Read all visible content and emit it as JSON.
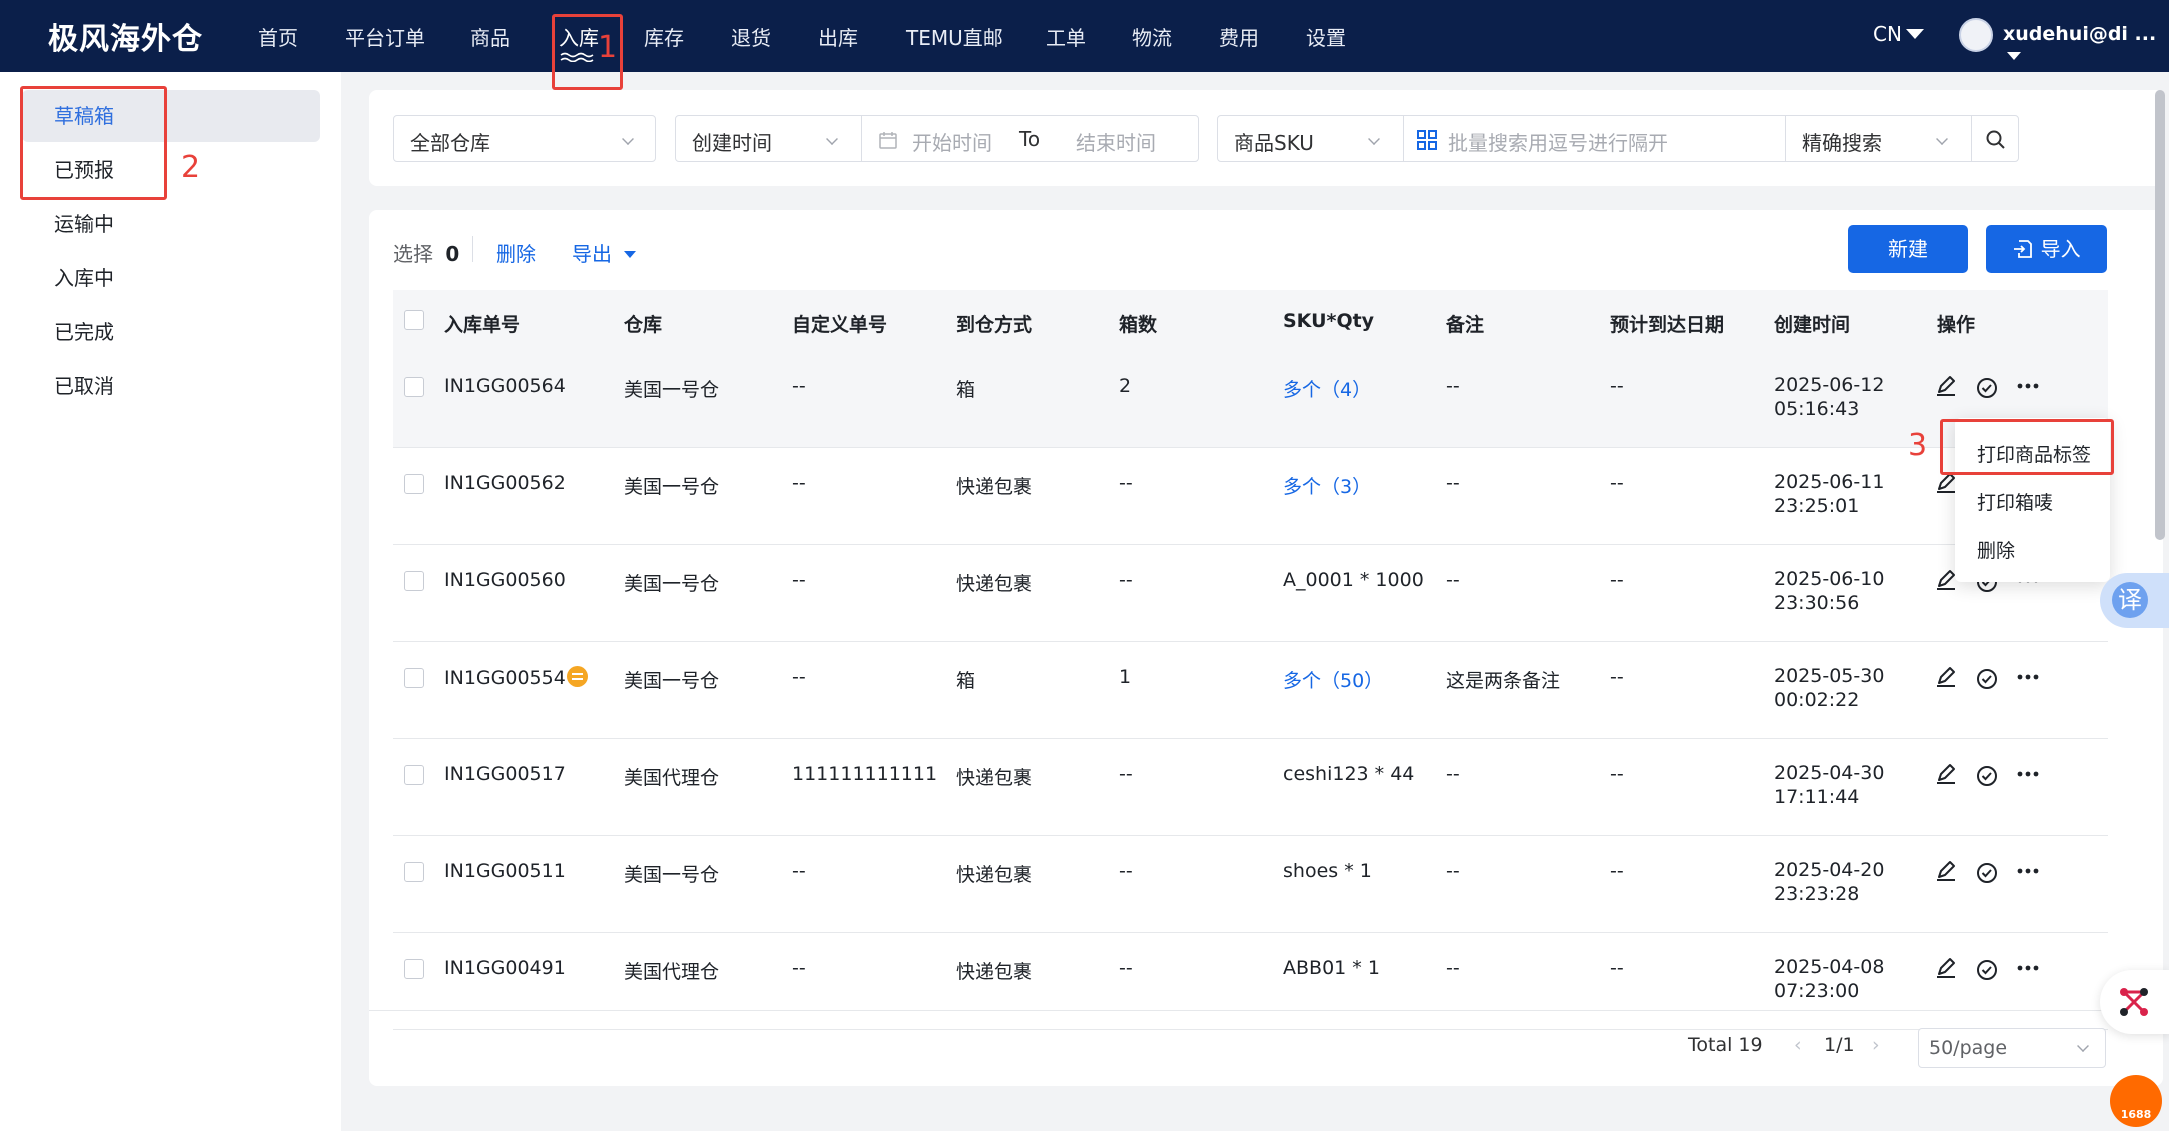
{
  "brand": "极风海外仓",
  "nav": [
    {
      "label": "首页"
    },
    {
      "label": "平台订单"
    },
    {
      "label": "商品"
    },
    {
      "label": "入库"
    },
    {
      "label": "库存"
    },
    {
      "label": "退货"
    },
    {
      "label": "出库"
    },
    {
      "label": "TEMU直邮"
    },
    {
      "label": "工单"
    },
    {
      "label": "物流"
    },
    {
      "label": "费用"
    },
    {
      "label": "设置"
    }
  ],
  "lang": "CN",
  "user": "xudehui@di ...",
  "annotations": {
    "n1": "1",
    "n2": "2",
    "n3": "3"
  },
  "sidebar": {
    "items": [
      {
        "label": "草稿箱"
      },
      {
        "label": "已预报"
      },
      {
        "label": "运输中"
      },
      {
        "label": "入库中"
      },
      {
        "label": "已完成"
      },
      {
        "label": "已取消"
      }
    ]
  },
  "filters": {
    "warehouse": "全部仓库",
    "time_type": "创建时间",
    "start_placeholder": "开始时间",
    "to_label": "To",
    "end_placeholder": "结束时间",
    "sku_type": "商品SKU",
    "batch_placeholder": "批量搜索用逗号进行隔开",
    "match_mode": "精确搜索"
  },
  "toolbar": {
    "selected_label": "选择",
    "selected_count": "0",
    "delete": "删除",
    "export": "导出",
    "new": "新建",
    "import": "导入"
  },
  "table": {
    "headers": {
      "order_no": "入库单号",
      "warehouse": "仓库",
      "custom_no": "自定义单号",
      "arrival": "到仓方式",
      "boxes": "箱数",
      "sku_qty": "SKU*Qty",
      "remark": "备注",
      "eta": "预计到达日期",
      "created": "创建时间",
      "ops": "操作"
    },
    "rows": [
      {
        "order_no": "IN1GG00564",
        "warehouse": "美国一号仓",
        "custom_no": "--",
        "arrival": "箱",
        "boxes": "2",
        "sku_qty": "多个（4）",
        "remark": "--",
        "eta": "--",
        "created_date": "2025-06-12",
        "created_time": "05:16:43"
      },
      {
        "order_no": "IN1GG00562",
        "warehouse": "美国一号仓",
        "custom_no": "--",
        "arrival": "快递包裹",
        "boxes": "--",
        "sku_qty": "多个（3）",
        "remark": "--",
        "eta": "--",
        "created_date": "2025-06-11",
        "created_time": "23:25:01"
      },
      {
        "order_no": "IN1GG00560",
        "warehouse": "美国一号仓",
        "custom_no": "--",
        "arrival": "快递包裹",
        "boxes": "--",
        "sku_qty": "A_0001 * 1000",
        "remark": "--",
        "eta": "--",
        "created_date": "2025-06-10",
        "created_time": "23:30:56"
      },
      {
        "order_no": "IN1GG00554",
        "warehouse": "美国一号仓",
        "custom_no": "--",
        "arrival": "箱",
        "boxes": "1",
        "sku_qty": "多个（50）",
        "remark": "这是两条备注",
        "eta": "--",
        "created_date": "2025-05-30",
        "created_time": "00:02:22"
      },
      {
        "order_no": "IN1GG00517",
        "warehouse": "美国代理仓",
        "custom_no": "111111111111",
        "arrival": "快递包裹",
        "boxes": "--",
        "sku_qty": "ceshi123 * 44",
        "remark": "--",
        "eta": "--",
        "created_date": "2025-04-30",
        "created_time": "17:11:44"
      },
      {
        "order_no": "IN1GG00511",
        "warehouse": "美国一号仓",
        "custom_no": "--",
        "arrival": "快递包裹",
        "boxes": "--",
        "sku_qty": "shoes * 1",
        "remark": "--",
        "eta": "--",
        "created_date": "2025-04-20",
        "created_time": "23:23:28"
      },
      {
        "order_no": "IN1GG00491",
        "warehouse": "美国代理仓",
        "custom_no": "--",
        "arrival": "快递包裹",
        "boxes": "--",
        "sku_qty": "ABB01 * 1",
        "remark": "--",
        "eta": "--",
        "created_date": "2025-04-08",
        "created_time": "07:23:00"
      }
    ]
  },
  "menu": {
    "print_labels": "打印商品标签",
    "print_box": "打印箱唛",
    "delete": "删除"
  },
  "pagination": {
    "total": "Total 19",
    "page": "1/1",
    "page_size": "50/page"
  },
  "floating": {
    "translate": "译",
    "badge_1688": "1688"
  },
  "colors": {
    "nav_bg": "#0b1f4a",
    "primary": "#1667e4",
    "annotation": "#e8413a",
    "badge": "#f5a623"
  }
}
